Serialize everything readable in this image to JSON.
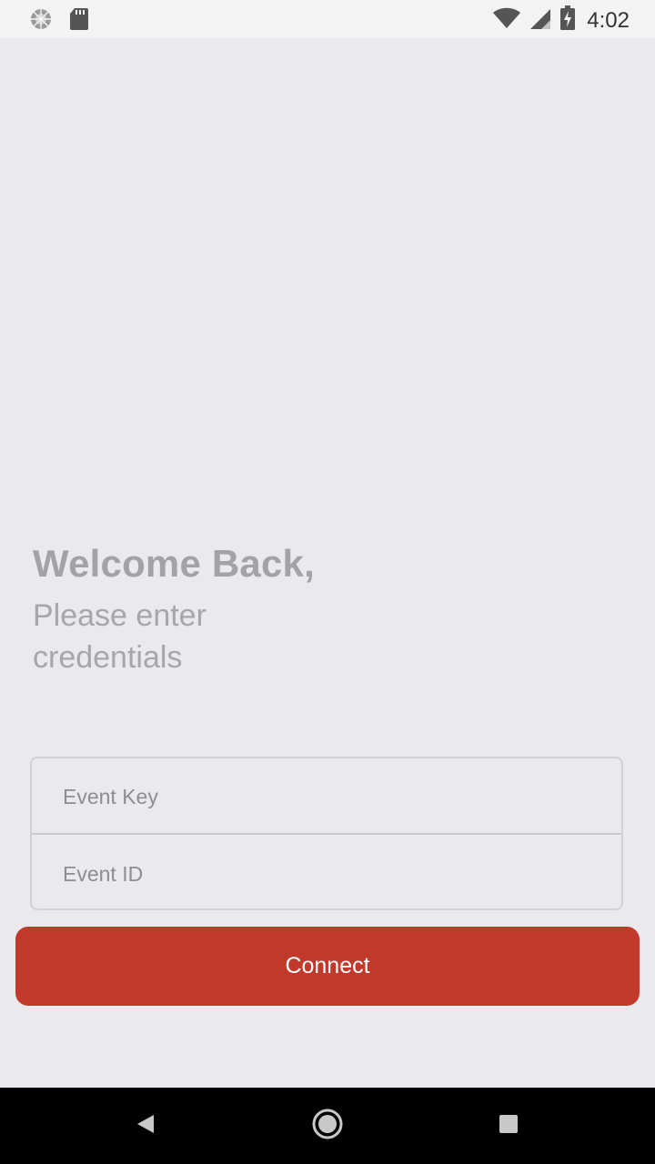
{
  "status_bar": {
    "time": "4:02",
    "icons": [
      "sync-icon",
      "sd-card-icon",
      "wifi-icon",
      "cell-signal-icon",
      "battery-charging-icon"
    ]
  },
  "welcome": {
    "title": "Welcome Back,",
    "subtitle": "Please enter credentials"
  },
  "form": {
    "event_key": {
      "placeholder": "Event Key",
      "value": ""
    },
    "event_id": {
      "placeholder": "Event ID",
      "value": ""
    }
  },
  "connect_button": {
    "label": "Connect",
    "color": "#c0392b"
  },
  "nav_bar": {
    "icons": [
      "back-icon",
      "home-icon",
      "recents-icon"
    ]
  },
  "colors": {
    "background": "#e9e9ee",
    "accent": "#c0392b",
    "status_bar": "#f3f3f3",
    "nav_bar": "#000000"
  }
}
